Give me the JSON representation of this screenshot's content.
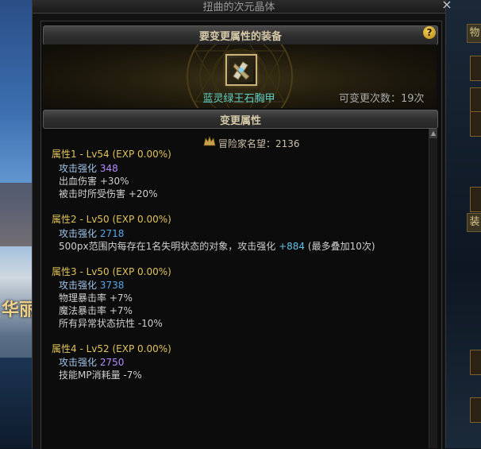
{
  "window": {
    "title": "扭曲的次元晶体",
    "close_glyph": "×"
  },
  "header": {
    "title": "要变更属性的装备",
    "help_glyph": "?"
  },
  "equipment": {
    "name": "蓝灵绿王石胸甲",
    "change_count": "可变更次数：19次"
  },
  "section": {
    "title": "变更属性"
  },
  "fame": {
    "label": "冒险家名望：2136"
  },
  "attributes": [
    {
      "title": "属性1 - Lv54 (EXP 0.00%)",
      "lines": [
        {
          "label": "攻击强化",
          "value": "348"
        },
        {
          "text": "出血伤害 +30%"
        },
        {
          "text": "被击时所受伤害 +20%"
        }
      ]
    },
    {
      "title": "属性2 - Lv50 (EXP 0.00%)",
      "lines": [
        {
          "label": "攻击强化",
          "value": "2718"
        },
        {
          "text_pre": "500px范围内每存在1名失明状态的对象，攻击强化",
          "value": "+884",
          "text_post": "(最多叠加10次)"
        }
      ]
    },
    {
      "title": "属性3 - Lv50 (EXP 0.00%)",
      "lines": [
        {
          "label": "攻击强化",
          "value": "3738"
        },
        {
          "text": "物理暴击率 +7%"
        },
        {
          "text": "魔法暴击率 +7%"
        },
        {
          "text": "所有异常状态抗性 -10%"
        }
      ]
    },
    {
      "title": "属性4 - Lv52 (EXP 0.00%)",
      "lines": [
        {
          "label": "攻击强化",
          "value": "2750"
        },
        {
          "text": "技能MP消耗量 -7%"
        }
      ]
    }
  ],
  "background": {
    "left_text": "华丽",
    "right_tab_1": "物",
    "right_tab_2": "装"
  },
  "colors": {
    "attr_title": "#e0c35a",
    "value_purple": "#b48cff",
    "value_blue": "#58a6e8",
    "item_name": "#5fd0c6"
  },
  "icons": [
    "close-icon",
    "help-icon",
    "armor-item-icon",
    "fame-crown-icon",
    "scroll-up-arrow-icon"
  ]
}
